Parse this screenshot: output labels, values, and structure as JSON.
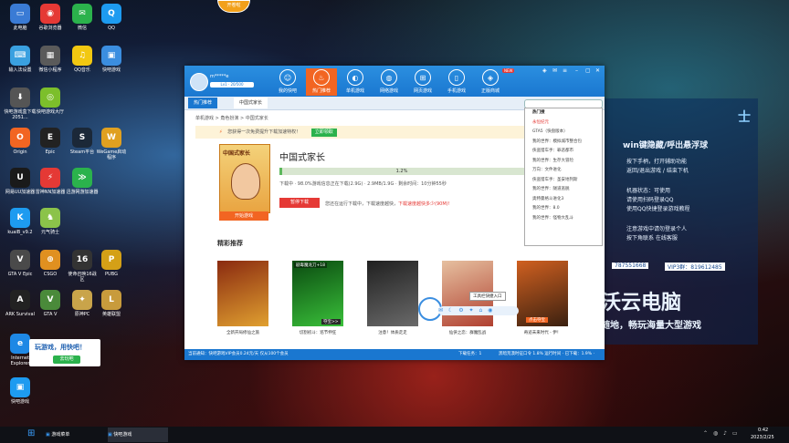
{
  "desktop": {
    "icons": [
      {
        "label": "此电脑",
        "color": "#3a7bd5",
        "glyph": "▭"
      },
      {
        "label": "谷歌浏览器",
        "color": "#e53935",
        "glyph": "◉"
      },
      {
        "label": "微信",
        "color": "#2bb24c",
        "glyph": "✉"
      },
      {
        "label": "QQ",
        "color": "#1d9bf0",
        "glyph": "Q"
      },
      {
        "label": "输入法设置",
        "color": "#3aa0e0",
        "glyph": "⌨"
      },
      {
        "label": "微信小程序",
        "color": "#5a5a5a",
        "glyph": "▦"
      },
      {
        "label": "QQ音乐",
        "color": "#f2c811",
        "glyph": "♫"
      },
      {
        "label": "快吧游戏",
        "color": "#3b8ee0",
        "glyph": "▣"
      },
      {
        "label": "快吧游戏盒下载2051...",
        "color": "#555",
        "glyph": "⬇"
      },
      {
        "label": "快吧游戏大厅",
        "color": "#7cbf2b",
        "glyph": "◎"
      },
      {
        "label": "Origin",
        "color": "#f26522",
        "glyph": "O"
      },
      {
        "label": "Epic",
        "color": "#222",
        "glyph": "E"
      },
      {
        "label": "Steam平台",
        "color": "#1b2838",
        "glyph": "S"
      },
      {
        "label": "WeGame启动程序",
        "color": "#e0a020",
        "glyph": "W"
      },
      {
        "label": "网易UU加速器",
        "color": "#1a1a1a",
        "glyph": "U"
      },
      {
        "label": "雷神NN加速器",
        "color": "#e53935",
        "glyph": "⚡"
      },
      {
        "label": "迅游网游加速器",
        "color": "#2bb24c",
        "glyph": "≫"
      },
      {
        "label": "kuaiB_v9.2",
        "color": "#1d9bf0",
        "glyph": "K"
      },
      {
        "label": "元气骑士",
        "color": "#8bc34a",
        "glyph": "♞"
      },
      {
        "label": "GTA V Epic",
        "color": "#4a4a4a",
        "glyph": "V"
      },
      {
        "label": "CSGO",
        "color": "#e09020",
        "glyph": "⊕"
      },
      {
        "label": "使命召唤16战区",
        "color": "#333",
        "glyph": "16"
      },
      {
        "label": "PUBG",
        "color": "#d4a017",
        "glyph": "P"
      },
      {
        "label": "ARK Survival",
        "color": "#222",
        "glyph": "A"
      },
      {
        "label": "GTA V",
        "color": "#4a8a3a",
        "glyph": "V"
      },
      {
        "label": "原神PC",
        "color": "#c9a44a",
        "glyph": "✦"
      },
      {
        "label": "英雄联盟",
        "color": "#c89b3c",
        "glyph": "L"
      },
      {
        "label": "Internet Explorer",
        "color": "#1e88e5",
        "glyph": "e"
      },
      {
        "label": "快吧游戏",
        "color": "#1d9bf0",
        "glyph": "▣"
      }
    ],
    "ad": {
      "text": "玩游戏，用快吧！",
      "button": "去玩吧"
    },
    "top_badge": "开卷啦"
  },
  "game_panel": {
    "title": "士",
    "lines": [
      "win键隐藏/呼出悬浮球",
      "按下手柄，打开辅助功能",
      "返回/退出游戏 / 结束下机",
      "机器状态：可使用",
      "请使用扫码登录QQ",
      "使用QQ快捷登录游戏教程",
      "注意游戏中请勿登录个人",
      "按下角联系 在线客服",
      "VIP3群：819612485"
    ],
    "line_big": [
      "沃云电脑",
      "随地，畅玩海量大型游戏"
    ],
    "qq_group": "787551668"
  },
  "window": {
    "user": {
      "name": "m*****e",
      "level": "Lv1 · 20/500"
    },
    "nav": [
      {
        "label": "我的快吧",
        "glyph": "☺"
      },
      {
        "label": "热门推荐",
        "glyph": "♨"
      },
      {
        "label": "单机游戏",
        "glyph": "◐"
      },
      {
        "label": "网络游戏",
        "glyph": "◍"
      },
      {
        "label": "网页游戏",
        "glyph": "⊞"
      },
      {
        "label": "手机游戏",
        "glyph": "▯"
      },
      {
        "label": "正版商城",
        "glyph": "◈"
      }
    ],
    "new_badge": "NEW",
    "tabs": [
      "热门推荐",
      "中国式家长"
    ],
    "breadcrumb": "单机游戏 > 角色扮演 > 中国式家长",
    "notice": {
      "text": "您获得一次免费提升下载加速特权！",
      "button": "立即领取"
    },
    "game": {
      "title": "中国式家长",
      "cover_title": "中国式家长",
      "start_button": "开始游戏",
      "progress": 0.012,
      "progress_text": "1.2%",
      "download_info": "下载中 · 98.0%游戏信息正在下载(2.9G) · 2.9MB/1.9G · 剩余时间：10分钟55秒",
      "pause_button": "暂停下载",
      "warn_text": "您还在运行下载中，下载速度越快，",
      "warn_link": "下载速度越快多少(90M)!"
    },
    "section_title": "精彩推荐",
    "recommendations": [
      {
        "label": "全新开局修仙之旅",
        "c1": "#8a2a10",
        "c2": "#e0a030"
      },
      {
        "label": "切割初斗：巡节伸狂",
        "c1": "#0a4a10",
        "c2": "#3ac03a"
      },
      {
        "label": "注意！体质走走",
        "c1": "#202020",
        "c2": "#6a6a6a"
      },
      {
        "label": "仙侠之恋：群魔乱战",
        "c1": "#e6c0a0",
        "c2": "#b04030"
      },
      {
        "label": "奇迹未来时代 - 伊！",
        "c1": "#d06020",
        "c2": "#3a2010"
      }
    ],
    "rec_badges": [
      "剧毒魔龙刀+18",
      "夺宝>>",
      "点击夺宝"
    ],
    "popup": {
      "header": "热门搜",
      "items": [
        "永恒纪元",
        "GTA5（快盘版本）",
        "我的世界：模拟城市整合包",
        "侠盗猎车手：罪恶都市",
        "我的世界：生存大冒险",
        "万向：文件进化",
        "侠盗猎车手：圣安地列斯",
        "我的世界：隧道逃脱",
        "奥特曼格斗进化3",
        "我的世界：8.0",
        "我的世界：怪物大乱斗"
      ]
    },
    "tool_tip": "工具栏快捷入口",
    "status": {
      "left": "当前通知：快吧游戏VIP会员0.24元/天 仅从100个会员",
      "mid": "下载任务：1",
      "right": "黑暗荒漠时征口令 1.8% 运行时间 · 已下载：1.9% · 7968/s"
    }
  },
  "taskbar": {
    "items": [
      "游戏菜单",
      "快吧游戏"
    ],
    "clock": "0:42",
    "date": "2023/2/25"
  }
}
